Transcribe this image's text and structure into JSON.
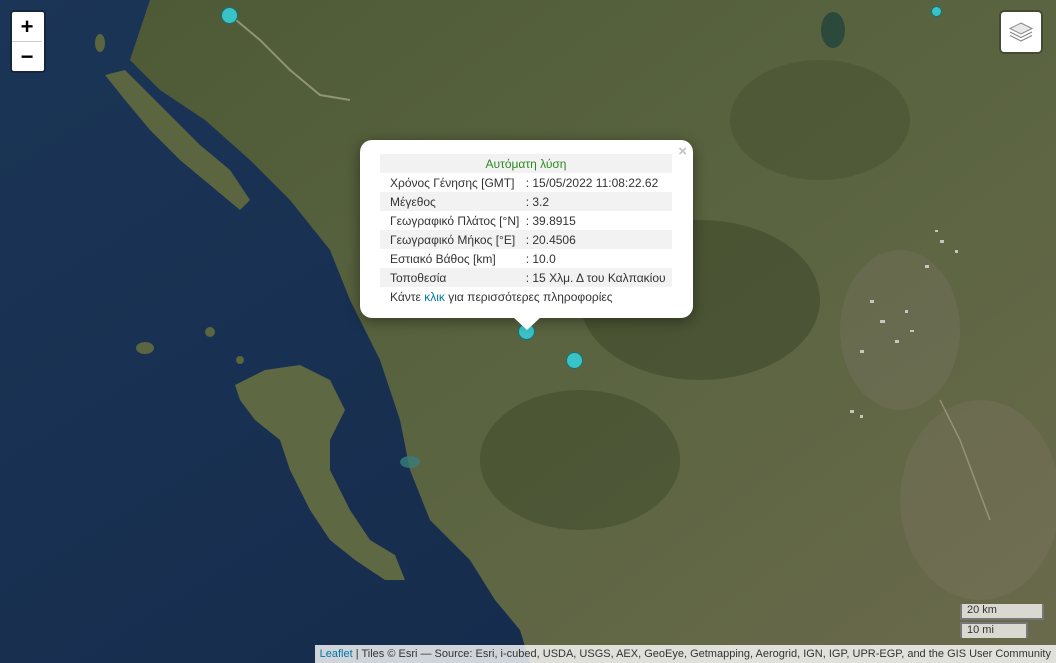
{
  "map": {
    "zoom_in_label": "+",
    "zoom_out_label": "−",
    "marker_color": "#39c3c6",
    "water_color": "#1e3a5f",
    "land_color": "#55613a"
  },
  "popup": {
    "title": "Αυτόματη λύση",
    "close_label": "×",
    "rows": [
      {
        "label": "Χρόνος Γένησης [GMT]",
        "value": ": 15/05/2022 11:08:22.62"
      },
      {
        "label": "Μέγεθος",
        "value": ": 3.2"
      },
      {
        "label": "Γεωγραφικό Πλάτος [°N]",
        "value": ": 39.8915"
      },
      {
        "label": "Γεωγραφικό Μήκος [°E]",
        "value": ": 20.4506"
      },
      {
        "label": "Εστιακό Βάθος [km]",
        "value": ": 10.0"
      },
      {
        "label": "Τοποθεσία",
        "value": ": 15 Χλμ. Δ του Καλπακίου"
      }
    ],
    "more_prefix": "Κάντε ",
    "more_link": "κλικ",
    "more_suffix": " για περισσότερες πληροφορίες"
  },
  "scale": {
    "km_label": "20 km",
    "mi_label": "10 mi"
  },
  "attribution": {
    "leaflet_link": "Leaflet",
    "text": " | Tiles © Esri — Source: Esri, i-cubed, USDA, USGS, AEX, GeoEye, Getmapping, Aerogrid, IGN, IGP, UPR-EGP, and the GIS User Community"
  }
}
